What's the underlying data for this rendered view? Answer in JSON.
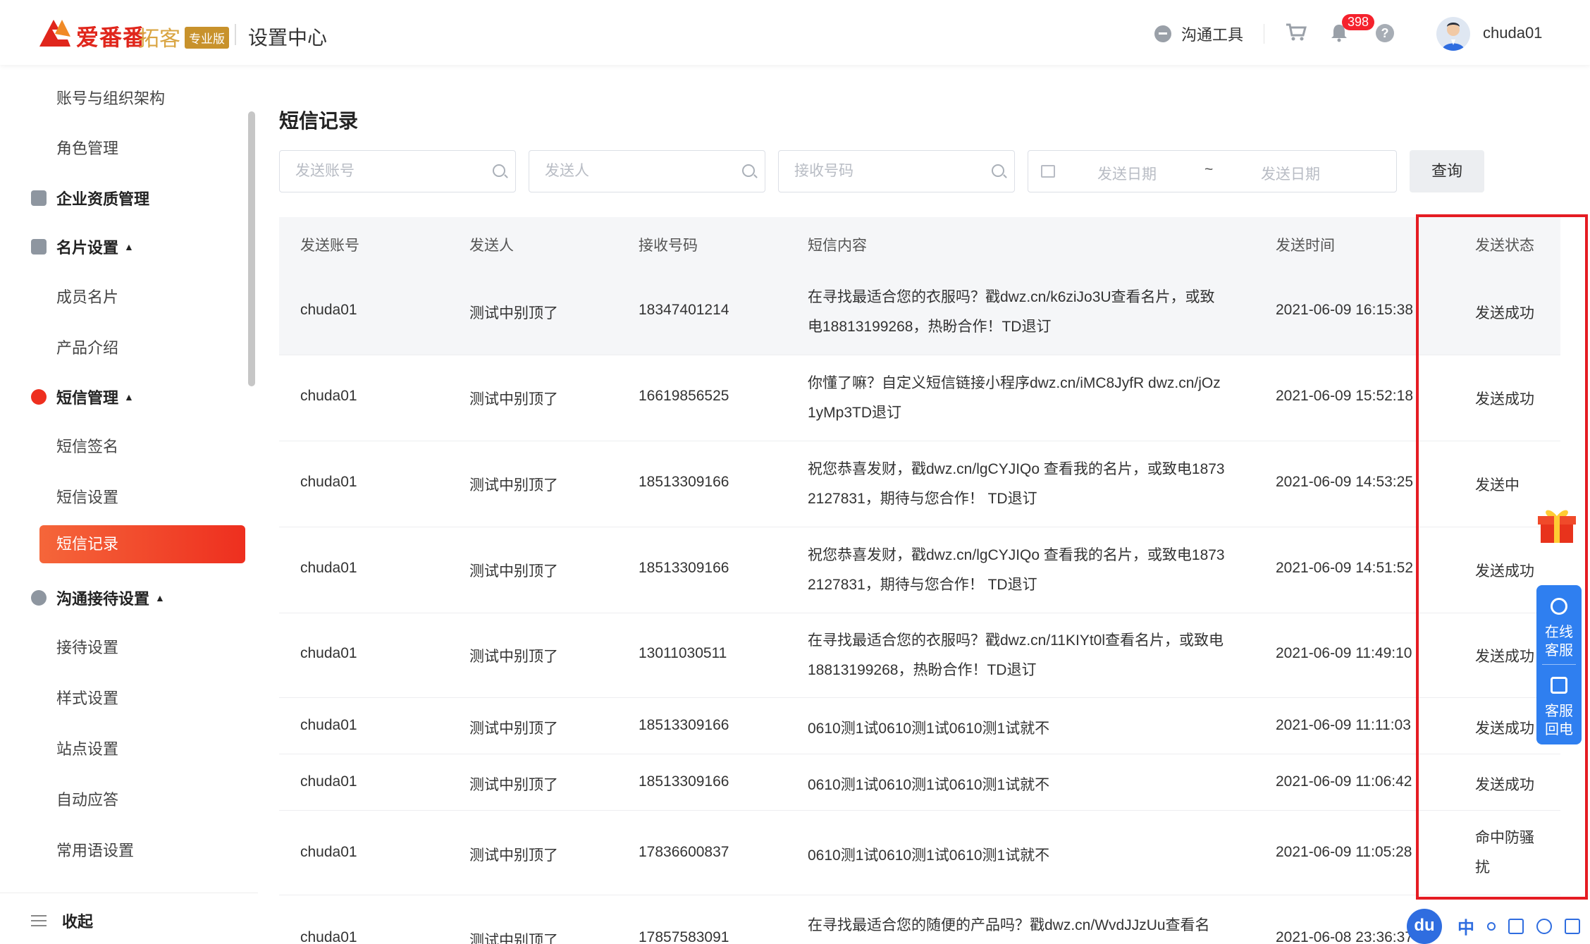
{
  "header": {
    "logo_text": "爱番番",
    "logo_sub": "拓客",
    "logo_badge": "专业版",
    "title": "设置中心",
    "comm_tool": "沟通工具",
    "notification_count": "398",
    "help": "?",
    "username": "chuda01"
  },
  "sidebar": {
    "items": [
      {
        "label": "账号与组织架构"
      },
      {
        "label": "角色管理"
      }
    ],
    "group_qualification": "企业资质管理",
    "group_card": "名片设置",
    "card_items": [
      "成员名片",
      "产品介绍"
    ],
    "group_sms": "短信管理",
    "sms_items": [
      "短信签名",
      "短信设置"
    ],
    "active_item": "短信记录",
    "group_reception": "沟通接待设置",
    "reception_items": [
      "接待设置",
      "样式设置",
      "站点设置",
      "自动应答",
      "常用语设置"
    ],
    "collapse": "收起"
  },
  "main": {
    "title": "短信记录",
    "filters": {
      "account_placeholder": "发送账号",
      "sender_placeholder": "发送人",
      "phone_placeholder": "接收号码",
      "date_start_placeholder": "发送日期",
      "date_sep": "~",
      "date_end_placeholder": "发送日期",
      "query_button": "查询"
    },
    "table": {
      "columns": [
        "发送账号",
        "发送人",
        "接收号码",
        "短信内容",
        "发送时间",
        "发送状态"
      ],
      "rows": [
        {
          "account": "chuda01",
          "sender": "测试中别顶了",
          "phone": "18347401214",
          "content_l1": "在寻找最适合您的衣服吗？戳dwz.cn/k6ziJo3U查看名片，或致",
          "content_l2": "电18813199268，热盼合作！TD退订",
          "time": "2021-06-09 16:15:38",
          "status": "发送成功"
        },
        {
          "account": "chuda01",
          "sender": "测试中别顶了",
          "phone": "16619856525",
          "content_l1": "你懂了嘛？自定义短信链接小程序dwz.cn/iMC8JyfR dwz.cn/jOz",
          "content_l2": "1yMp3TD退订",
          "time": "2021-06-09 15:52:18",
          "status": "发送成功"
        },
        {
          "account": "chuda01",
          "sender": "测试中别顶了",
          "phone": "18513309166",
          "content_l1": "祝您恭喜发财，戳dwz.cn/lgCYJIQo 查看我的名片，或致电1873",
          "content_l2": "2127831，期待与您合作！ TD退订",
          "time": "2021-06-09 14:53:25",
          "status": "发送中"
        },
        {
          "account": "chuda01",
          "sender": "测试中别顶了",
          "phone": "18513309166",
          "content_l1": "祝您恭喜发财，戳dwz.cn/lgCYJIQo 查看我的名片，或致电1873",
          "content_l2": "2127831，期待与您合作！ TD退订",
          "time": "2021-06-09 14:51:52",
          "status": "发送成功"
        },
        {
          "account": "chuda01",
          "sender": "测试中别顶了",
          "phone": "13011030511",
          "content_l1": "在寻找最适合您的衣服吗？戳dwz.cn/11KIYt0l查看名片，或致电",
          "content_l2": "18813199268，热盼合作！TD退订",
          "time": "2021-06-09 11:49:10",
          "status": "发送成功"
        },
        {
          "account": "chuda01",
          "sender": "测试中别顶了",
          "phone": "18513309166",
          "content_l1": "0610测1试0610测1试0610测1试就不",
          "content_l2": "",
          "time": "2021-06-09 11:11:03",
          "status": "发送成功"
        },
        {
          "account": "chuda01",
          "sender": "测试中别顶了",
          "phone": "18513309166",
          "content_l1": "0610测1试0610测1试0610测1试就不",
          "content_l2": "",
          "time": "2021-06-09 11:06:42",
          "status": "发送成功"
        },
        {
          "account": "chuda01",
          "sender": "测试中别顶了",
          "phone": "17836600837",
          "content_l1": "0610测1试0610测1试0610测1试就不",
          "content_l2": "",
          "time": "2021-06-09 11:05:28",
          "status_l1": "命中防骚",
          "status_l2": "扰"
        },
        {
          "account": "chuda01",
          "sender": "测试中别顶了",
          "phone": "17857583091",
          "content_l1": "在寻找最适合您的随便的产品吗？戳dwz.cn/WvdJJzUu查看名",
          "content_l2": "",
          "time": "2021-06-08 23:36:37",
          "status": ""
        }
      ]
    }
  },
  "float": {
    "online_service_l1": "在线",
    "online_service_l2": "客服",
    "callback_l1": "客服",
    "callback_l2": "回电"
  },
  "ime": {
    "du": "du",
    "lang": "中"
  },
  "colors": {
    "accent": "#ee2f1f",
    "highlight_frame": "#e51c23",
    "service_blue": "#2f7ff0"
  }
}
